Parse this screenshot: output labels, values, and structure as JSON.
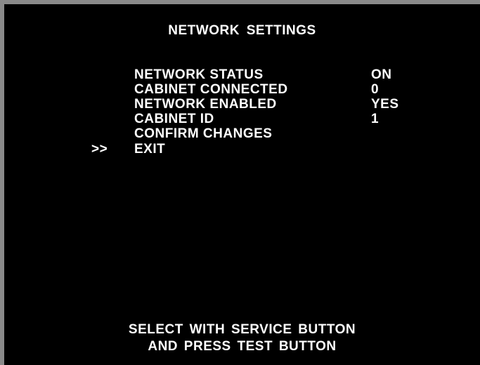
{
  "screen": {
    "title": "NETWORK  SETTINGS",
    "cursor": ">>",
    "items": [
      {
        "label": "NETWORK STATUS",
        "value": "ON"
      },
      {
        "label": "CABINET CONNECTED",
        "value": "0"
      },
      {
        "label": "NETWORK ENABLED",
        "value": "YES"
      },
      {
        "label": "CABINET ID",
        "value": "1"
      },
      {
        "label": "CONFIRM CHANGES",
        "value": ""
      },
      {
        "label": "EXIT",
        "value": ""
      }
    ],
    "footer_line1": "SELECT WITH  SERVICE  BUTTON",
    "footer_line2": "AND PRESS TEST BUTTON"
  }
}
